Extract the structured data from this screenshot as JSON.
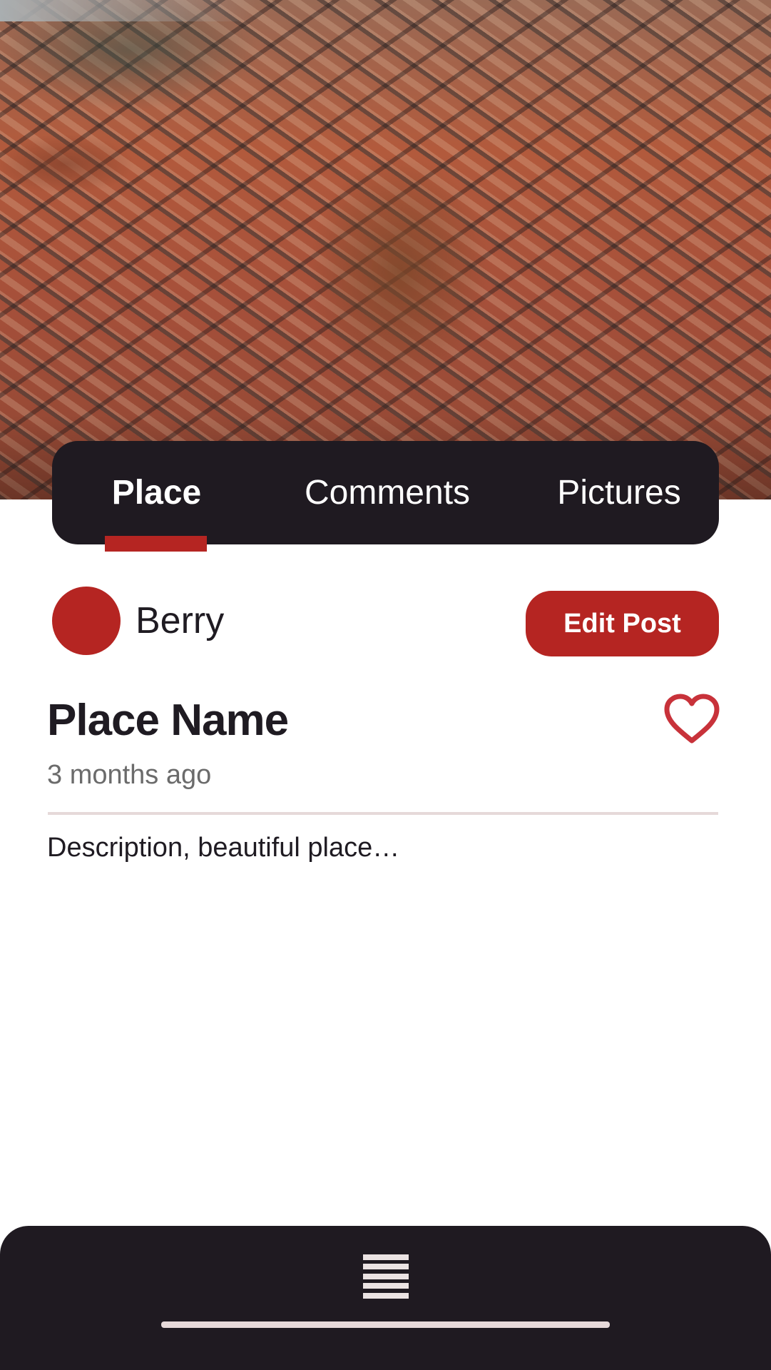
{
  "tabs": [
    {
      "label": "Place",
      "active": true
    },
    {
      "label": "Comments",
      "active": false
    },
    {
      "label": "Pictures",
      "active": false
    }
  ],
  "post": {
    "author": "Berry",
    "edit_label": "Edit Post",
    "title": "Place Name",
    "time": "3 months ago",
    "description": "Description, beautiful place…",
    "favorite_icon": "heart-outline-icon"
  },
  "bottom_bar": {
    "menu_icon": "menu-icon"
  },
  "colors": {
    "accent": "#b52522",
    "dark": "#1f1a21",
    "divider": "#e6d9d9"
  }
}
